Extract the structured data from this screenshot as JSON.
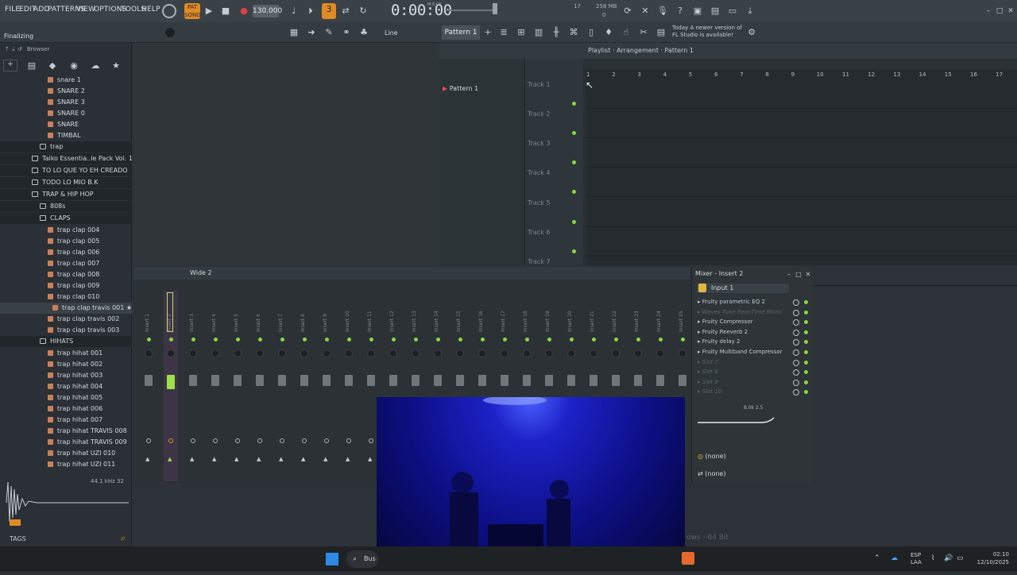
{
  "menu": [
    "FILE",
    "EDIT",
    "ADD",
    "PATTERNS",
    "VIEW",
    "OPTIONS",
    "TOOLS",
    "HELP"
  ],
  "status": "Finalizing",
  "tempo": "130.000",
  "time": "0:00:00",
  "time_label": "M:S:CS",
  "cpu": "17",
  "mem": "258 MB",
  "cpu2": "0",
  "pattern": "Pattern 1",
  "snap": "Line",
  "news": {
    "line1": "Today  A newer version of",
    "line2": "FL Studio is available!"
  },
  "browser": {
    "title": "Browser",
    "items": [
      {
        "label": "snare 1",
        "kind": "file"
      },
      {
        "label": "SNARE 2",
        "kind": "file"
      },
      {
        "label": "SNARE 3",
        "kind": "file"
      },
      {
        "label": "SNARE 0",
        "kind": "file"
      },
      {
        "label": "SNARE",
        "kind": "file"
      },
      {
        "label": "TIMBAL",
        "kind": "file"
      },
      {
        "label": "trap",
        "kind": "folder"
      },
      {
        "label": "Taiko Essentia..le Pack Vol. 1",
        "kind": "folder"
      },
      {
        "label": "TO LO QUE YO EH CREADO",
        "kind": "folder"
      },
      {
        "label": "TODO LO MIO B.K",
        "kind": "folder"
      },
      {
        "label": "TRAP & HIP HOP",
        "kind": "folder"
      },
      {
        "label": "808s",
        "kind": "folder"
      },
      {
        "label": "CLAPS",
        "kind": "folder"
      },
      {
        "label": "trap clap 004",
        "kind": "file"
      },
      {
        "label": "trap clap 005",
        "kind": "file"
      },
      {
        "label": "trap clap 006",
        "kind": "file"
      },
      {
        "label": "trap clap 007",
        "kind": "file"
      },
      {
        "label": "trap clap 008",
        "kind": "file"
      },
      {
        "label": "trap clap 009",
        "kind": "file"
      },
      {
        "label": "trap clap 010",
        "kind": "file"
      },
      {
        "label": "trap clap travis 001 ★",
        "kind": "file"
      },
      {
        "label": "trap clap travis 002",
        "kind": "file"
      },
      {
        "label": "trap clap travis 003",
        "kind": "file"
      },
      {
        "label": "HIHATS",
        "kind": "folder"
      },
      {
        "label": "trap hihat 001",
        "kind": "file"
      },
      {
        "label": "trap hihat 002",
        "kind": "file"
      },
      {
        "label": "trap hihat 003",
        "kind": "file"
      },
      {
        "label": "trap hihat 004",
        "kind": "file"
      },
      {
        "label": "trap hihat 005",
        "kind": "file"
      },
      {
        "label": "trap hihat 006",
        "kind": "file"
      },
      {
        "label": "trap hihat 007",
        "kind": "file"
      },
      {
        "label": "trap hihat TRAVIS 008",
        "kind": "file"
      },
      {
        "label": "trap hihat TRAVIS 009",
        "kind": "file"
      },
      {
        "label": "trap hihat UZI 010",
        "kind": "file"
      },
      {
        "label": "trap hihat UZI 011",
        "kind": "file"
      }
    ],
    "sample_info": "44.1 kHz 32",
    "tags": "TAGS"
  },
  "playlist": {
    "breadcrumb": "Playlist · Arrangement · Pattern 1",
    "pattern_item": "Pattern 1",
    "tracks": [
      "Track 1",
      "Track 2",
      "Track 3",
      "Track 4",
      "Track 5",
      "Track 6",
      "Track 7"
    ],
    "ruler": [
      "1",
      "2",
      "3",
      "4",
      "5",
      "6",
      "7",
      "8",
      "9",
      "10",
      "11",
      "12",
      "13",
      "14",
      "15",
      "16",
      "17"
    ]
  },
  "mixer": {
    "title": "Wide 2",
    "strips": [
      "Insert 1",
      "Insert 2",
      "Insert 3",
      "Insert 4",
      "Insert 5",
      "Insert 6",
      "Insert 7",
      "Insert 8",
      "Insert 9",
      "Insert 10",
      "Insert 11",
      "Insert 12",
      "Insert 13",
      "Insert 14",
      "Insert 15",
      "Insert 16",
      "Insert 17",
      "Insert 18",
      "Insert 19",
      "Insert 20",
      "Insert 21",
      "Insert 22",
      "Insert 23",
      "Insert 24",
      "Insert 25"
    ]
  },
  "insert": {
    "title": "Mixer - Insert 2",
    "input": "Input 1",
    "slots": [
      {
        "label": "Fruity parametric EQ 2",
        "active": true
      },
      {
        "label": "Waves Tune Real-Time Mono",
        "active": false
      },
      {
        "label": "Fruity Compressor",
        "active": true
      },
      {
        "label": "Fruity Reeverb 2",
        "active": true
      },
      {
        "label": "Fruity delay 2",
        "active": true
      },
      {
        "label": "Fruity Multiband Compressor",
        "active": true
      },
      {
        "label": "Slot 7",
        "active": false
      },
      {
        "label": "Slot 8",
        "active": false
      },
      {
        "label": "Slot 9",
        "active": false
      },
      {
        "label": "Slot 10",
        "active": false
      }
    ],
    "eq_label": "8.0k 2.5",
    "out1": "(none)",
    "out2": "(none)"
  },
  "taskbar": {
    "search": "Bus",
    "lang1": "ESP",
    "lang2": "LAA",
    "clock": "02:10",
    "date": "12/10/2025"
  },
  "watermark": "ows - 64 Bit"
}
